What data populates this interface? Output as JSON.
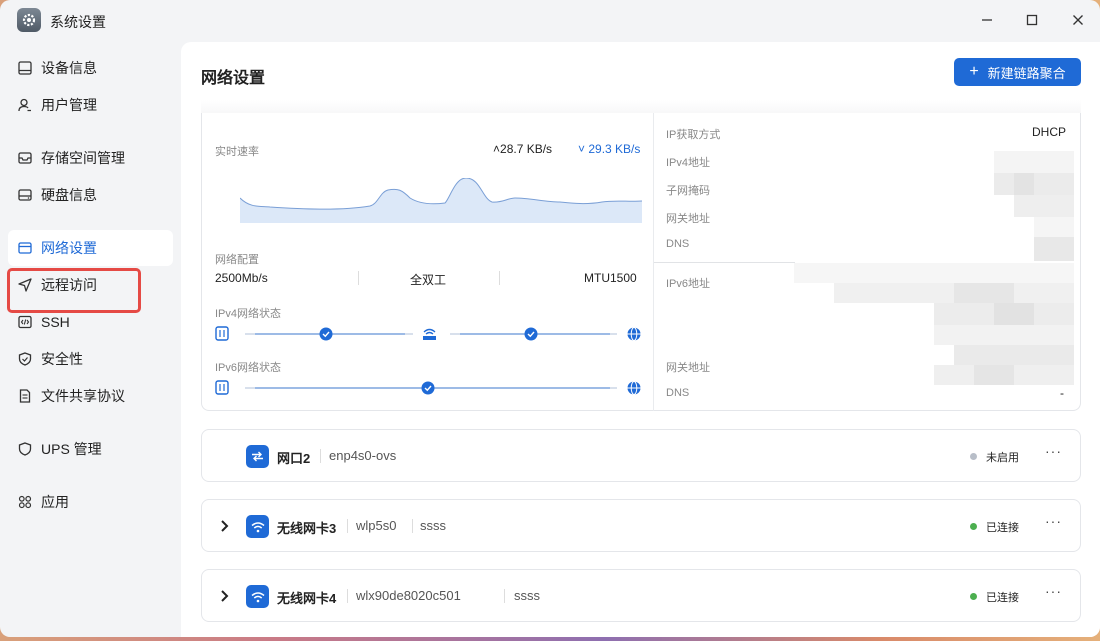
{
  "window": {
    "title": "系统设置",
    "app_icon": "gear-icon"
  },
  "sidebar": {
    "items": [
      {
        "label": "设备信息",
        "icon": "monitor-icon"
      },
      {
        "label": "用户管理",
        "icon": "user-icon"
      },
      {
        "label": "存储空间管理",
        "icon": "storage-icon"
      },
      {
        "label": "硬盘信息",
        "icon": "disk-icon"
      },
      {
        "label": "网络设置",
        "icon": "network-icon",
        "active": true
      },
      {
        "label": "远程访问",
        "icon": "send-icon"
      },
      {
        "label": "SSH",
        "icon": "code-icon"
      },
      {
        "label": "安全性",
        "icon": "shield-icon"
      },
      {
        "label": "文件共享协议",
        "icon": "file-icon"
      },
      {
        "label": "UPS 管理",
        "icon": "shield-icon"
      },
      {
        "label": "应用",
        "icon": "apps-icon"
      }
    ]
  },
  "main": {
    "title": "网络设置",
    "new_button": "新建链路聚合",
    "detail": {
      "speed_label": "实时速率",
      "speed_up": "28.7 KB/s",
      "speed_down": "29.3 KB/s",
      "config_label": "网络配置",
      "config": {
        "speed": "2500Mb/s",
        "duplex": "全双工",
        "mtu": "MTU1500"
      },
      "ipv4_status_label": "IPv4网络状态",
      "ipv6_status_label": "IPv6网络状态",
      "ip_fields": {
        "ip_method_label": "IP获取方式",
        "ip_method_value": "DHCP",
        "ipv4_label": "IPv4地址",
        "subnet_label": "子网掩码",
        "gateway_label": "网关地址",
        "dns_label": "DNS",
        "ipv6_label": "IPv6地址",
        "gateway6_label": "网关地址",
        "dns6_label": "DNS",
        "dns6_value": "-"
      }
    },
    "interfaces": [
      {
        "name": "网口2",
        "device": "enp4s0-ovs",
        "ssid": "",
        "status": "未启用",
        "status_color": "#b8bec8",
        "icon": "ethernet-icon",
        "expandable": false
      },
      {
        "name": "无线网卡3",
        "device": "wlp5s0",
        "ssid": "ssss",
        "status": "已连接",
        "status_color": "#4caf50",
        "icon": "wifi-icon",
        "expandable": true
      },
      {
        "name": "无线网卡4",
        "device": "wlx90de8020c501",
        "ssid": "ssss",
        "status": "已连接",
        "status_color": "#4caf50",
        "icon": "wifi-icon",
        "expandable": true
      }
    ]
  },
  "colors": {
    "accent": "#1f6ad6",
    "highlight_border": "#e54a45"
  }
}
